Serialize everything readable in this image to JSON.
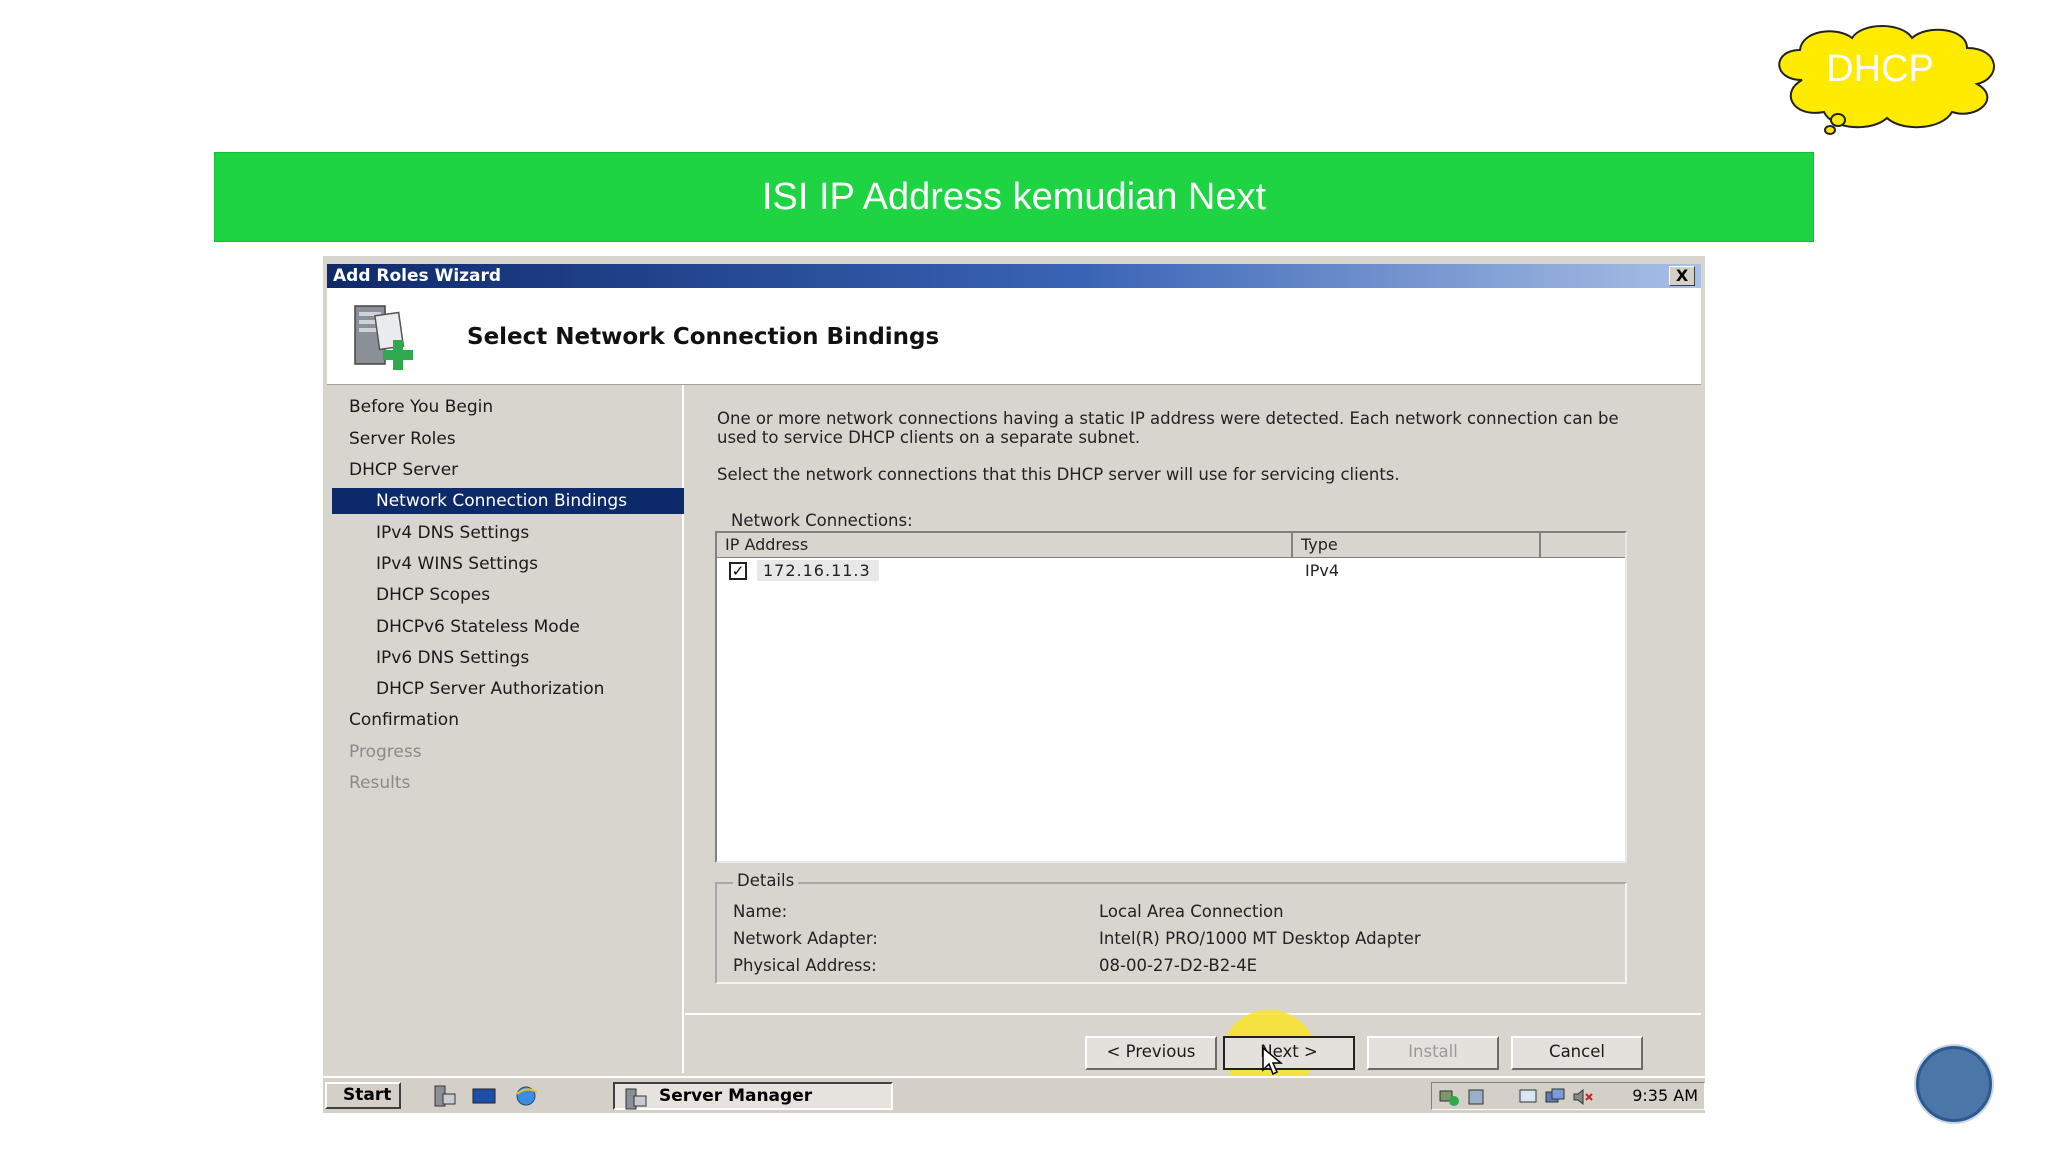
{
  "slide": {
    "badge": "DHCP",
    "banner": "ISI IP Address kemudian Next"
  },
  "window": {
    "title": "Add Roles Wizard",
    "close_label": "X",
    "heading": "Select Network Connection Bindings"
  },
  "nav": {
    "items": [
      {
        "label": "Before You Begin"
      },
      {
        "label": "Server Roles"
      },
      {
        "label": "DHCP Server"
      },
      {
        "label": "Network Connection Bindings"
      },
      {
        "label": "IPv4 DNS Settings"
      },
      {
        "label": "IPv4 WINS Settings"
      },
      {
        "label": "DHCP Scopes"
      },
      {
        "label": "DHCPv6 Stateless Mode"
      },
      {
        "label": "IPv6 DNS Settings"
      },
      {
        "label": "DHCP Server Authorization"
      },
      {
        "label": "Confirmation"
      },
      {
        "label": "Progress"
      },
      {
        "label": "Results"
      }
    ],
    "selected_index": 3
  },
  "content": {
    "description": "One or more network connections having a static IP address were detected. Each network connection can be used to service DHCP clients on a separate subnet.",
    "instruction": "Select the network connections that this DHCP server will use for servicing clients.",
    "connections_label": "Network Connections:",
    "columns": [
      "IP Address",
      "Type"
    ],
    "rows": [
      {
        "checked": true,
        "ip": "172.16.11.3",
        "type": "IPv4"
      }
    ],
    "details": {
      "legend": "Details",
      "fields": [
        {
          "label": "Name:",
          "value": "Local Area Connection"
        },
        {
          "label": "Network Adapter:",
          "value": "Intel(R) PRO/1000 MT Desktop Adapter"
        },
        {
          "label": "Physical Address:",
          "value": "08-00-27-D2-B2-4E"
        }
      ]
    }
  },
  "buttons": {
    "previous": "< Previous",
    "next": "Next >",
    "install": "Install",
    "cancel": "Cancel"
  },
  "taskbar": {
    "start": "Start",
    "task": "Server Manager",
    "clock": "9:35 AM"
  },
  "colors": {
    "banner": "#1ed443",
    "badge": "#ffeb00",
    "selection": "#0c2a6a",
    "highlight": "#fae428"
  }
}
